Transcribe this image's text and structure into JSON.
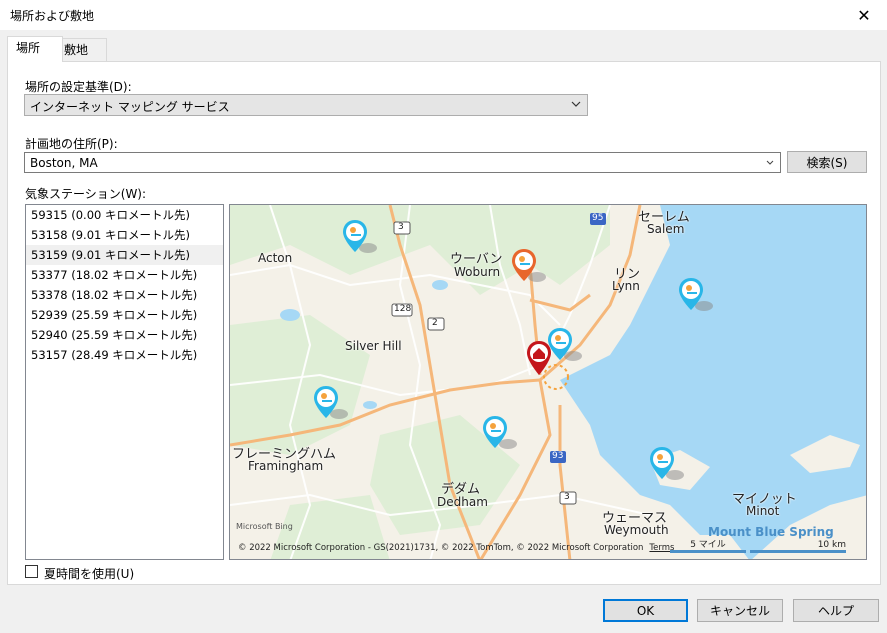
{
  "window": {
    "title": "場所および敷地",
    "close_glyph": "✕"
  },
  "tabs": [
    {
      "label": "場所"
    },
    {
      "label": "敷地"
    }
  ],
  "location_basis": {
    "label": "場所の設定基準(D):",
    "value": "インターネット マッピング サービス"
  },
  "address": {
    "label": "計画地の住所(P):",
    "value": "Boston, MA",
    "search_button": "検索(S)"
  },
  "stations": {
    "label": "気象ステーション(W):",
    "items": [
      {
        "text": "59315 (0.00 キロメートル先)"
      },
      {
        "text": "53158 (9.01 キロメートル先)"
      },
      {
        "text": "53159 (9.01 キロメートル先)"
      },
      {
        "text": "53377 (18.02 キロメートル先)"
      },
      {
        "text": "53378 (18.02 キロメートル先)"
      },
      {
        "text": "52939 (25.59 キロメートル先)"
      },
      {
        "text": "52940 (25.59 キロメートル先)"
      },
      {
        "text": "53157 (28.49 キロメートル先)"
      }
    ],
    "selected_index": 2
  },
  "map": {
    "places": {
      "acton": "Acton",
      "woburn_jp": "ウーバン",
      "woburn": "Woburn",
      "salem_jp": "セーレム",
      "salem": "Salem",
      "lynn_jp": "リン",
      "lynn": "Lynn",
      "silver_hill": "Silver Hill",
      "framingham_jp": "フレーミングハム",
      "framingham": "Framingham",
      "dedham_jp": "デダム",
      "dedham": "Dedham",
      "weymouth_jp": "ウェーマス",
      "weymouth": "Weymouth",
      "minot_jp": "マイノット",
      "minot": "Minot",
      "mount_blue_spring": "Mount Blue Spring"
    },
    "road_shields": {
      "r3a": "3",
      "r128": "128",
      "r2": "2",
      "i95": "95",
      "i93": "93",
      "r3b": "3"
    },
    "copyright": "© 2022 Microsoft Corporation - GS(2021)1731, © 2022 TomTom, © 2022 Microsoft Corporation",
    "terms": "Terms",
    "scale_miles": "5 マイル",
    "scale_km": "10 km",
    "bing": "Microsoft Bing",
    "colors": {
      "water": "#a6d8f5",
      "land": "#f4f1e8",
      "green": "#d8ead0",
      "highway": "#f5b77a",
      "pin_station": "#29b6e8",
      "pin_selected": "#e8662c",
      "pin_home": "#c4161c"
    }
  },
  "dst": {
    "label": "夏時間を使用(U)",
    "checked": false
  },
  "buttons": {
    "ok": "OK",
    "cancel": "キャンセル",
    "help": "ヘルプ"
  }
}
